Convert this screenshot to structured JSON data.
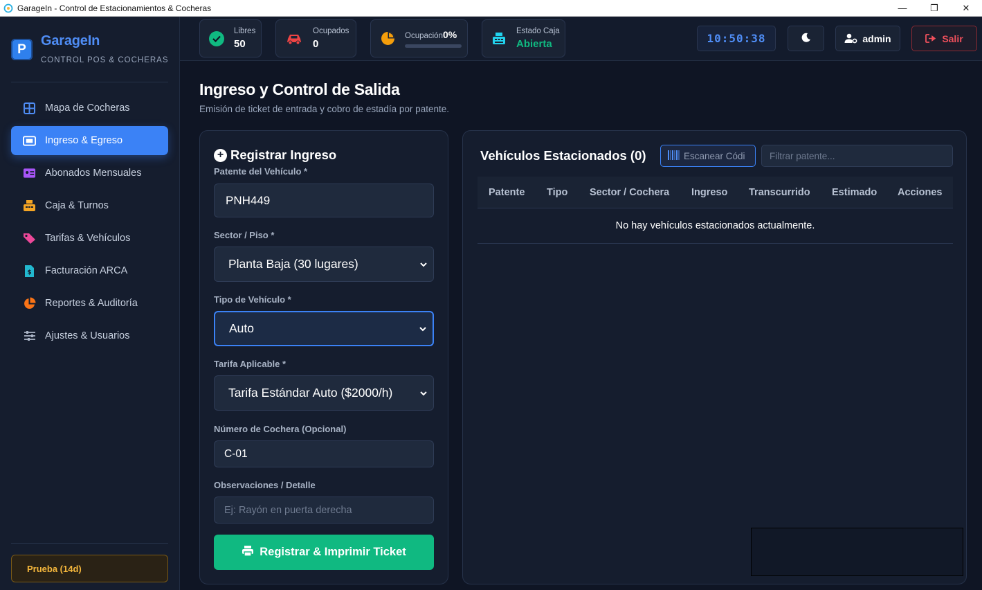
{
  "window": {
    "title": "GarageIn - Control de Estacionamientos & Cocheras",
    "minimize": "—",
    "maximize": "❐",
    "close": "✕"
  },
  "brand": {
    "name": "GarageIn",
    "subtitle": "CONTROL POS & COCHERAS",
    "logo_letter": "P"
  },
  "nav": [
    {
      "label": "Mapa de Cocheras",
      "icon": "grid-icon",
      "active": false
    },
    {
      "label": "Ingreso & Egreso",
      "icon": "ticket-icon",
      "active": true
    },
    {
      "label": "Abonados Mensuales",
      "icon": "id-card-icon",
      "active": false
    },
    {
      "label": "Caja & Turnos",
      "icon": "cash-register-icon",
      "active": false
    },
    {
      "label": "Tarifas & Vehículos",
      "icon": "tags-icon",
      "active": false
    },
    {
      "label": "Facturación ARCA",
      "icon": "invoice-icon",
      "active": false
    },
    {
      "label": "Reportes & Auditoría",
      "icon": "pie-chart-icon",
      "active": false
    },
    {
      "label": "Ajustes & Usuarios",
      "icon": "sliders-icon",
      "active": false
    }
  ],
  "trial": "Prueba (14d)",
  "stats": {
    "libres": {
      "label": "Libres",
      "value": "50"
    },
    "ocupados": {
      "label": "Ocupados",
      "value": "0"
    },
    "ocupacion": {
      "label": "Ocupación",
      "value": "0%",
      "progress": 0
    },
    "caja": {
      "label": "Estado Caja",
      "value": "Abierta"
    }
  },
  "topbar": {
    "clock": "10:50:38",
    "user": "admin",
    "logout": "Salir"
  },
  "page": {
    "title": "Ingreso y Control de Salida",
    "subtitle": "Emisión de ticket de entrada y cobro de estadía por patente."
  },
  "form": {
    "title": "Registrar Ingreso",
    "plate_label": "Patente del Vehículo *",
    "plate_value": "PNH449",
    "sector_label": "Sector / Piso *",
    "sector_value": "Planta Baja (30 lugares)",
    "type_label": "Tipo de Vehículo *",
    "type_value": "Auto",
    "rate_label": "Tarifa Aplicable *",
    "rate_value": "Tarifa Estándar Auto ($2000/h)",
    "spot_label": "Número de Cochera (Opcional)",
    "spot_value": "C-01",
    "notes_label": "Observaciones / Detalle",
    "notes_placeholder": "Ej: Rayón en puerta derecha",
    "submit": "Registrar & Imprimir Ticket"
  },
  "list": {
    "title": "Vehículos Estacionados (0)",
    "scan_placeholder": "Escanear Códi",
    "filter_placeholder": "Filtrar patente...",
    "columns": [
      "Patente",
      "Tipo",
      "Sector / Cochera",
      "Ingreso",
      "Transcurrido",
      "Estimado",
      "Acciones"
    ],
    "empty": "No hay vehículos estacionados actualmente."
  },
  "colors": {
    "accent": "#3b82f6",
    "success": "#10b981",
    "danger": "#f0505c",
    "warning": "#f5b73c"
  }
}
